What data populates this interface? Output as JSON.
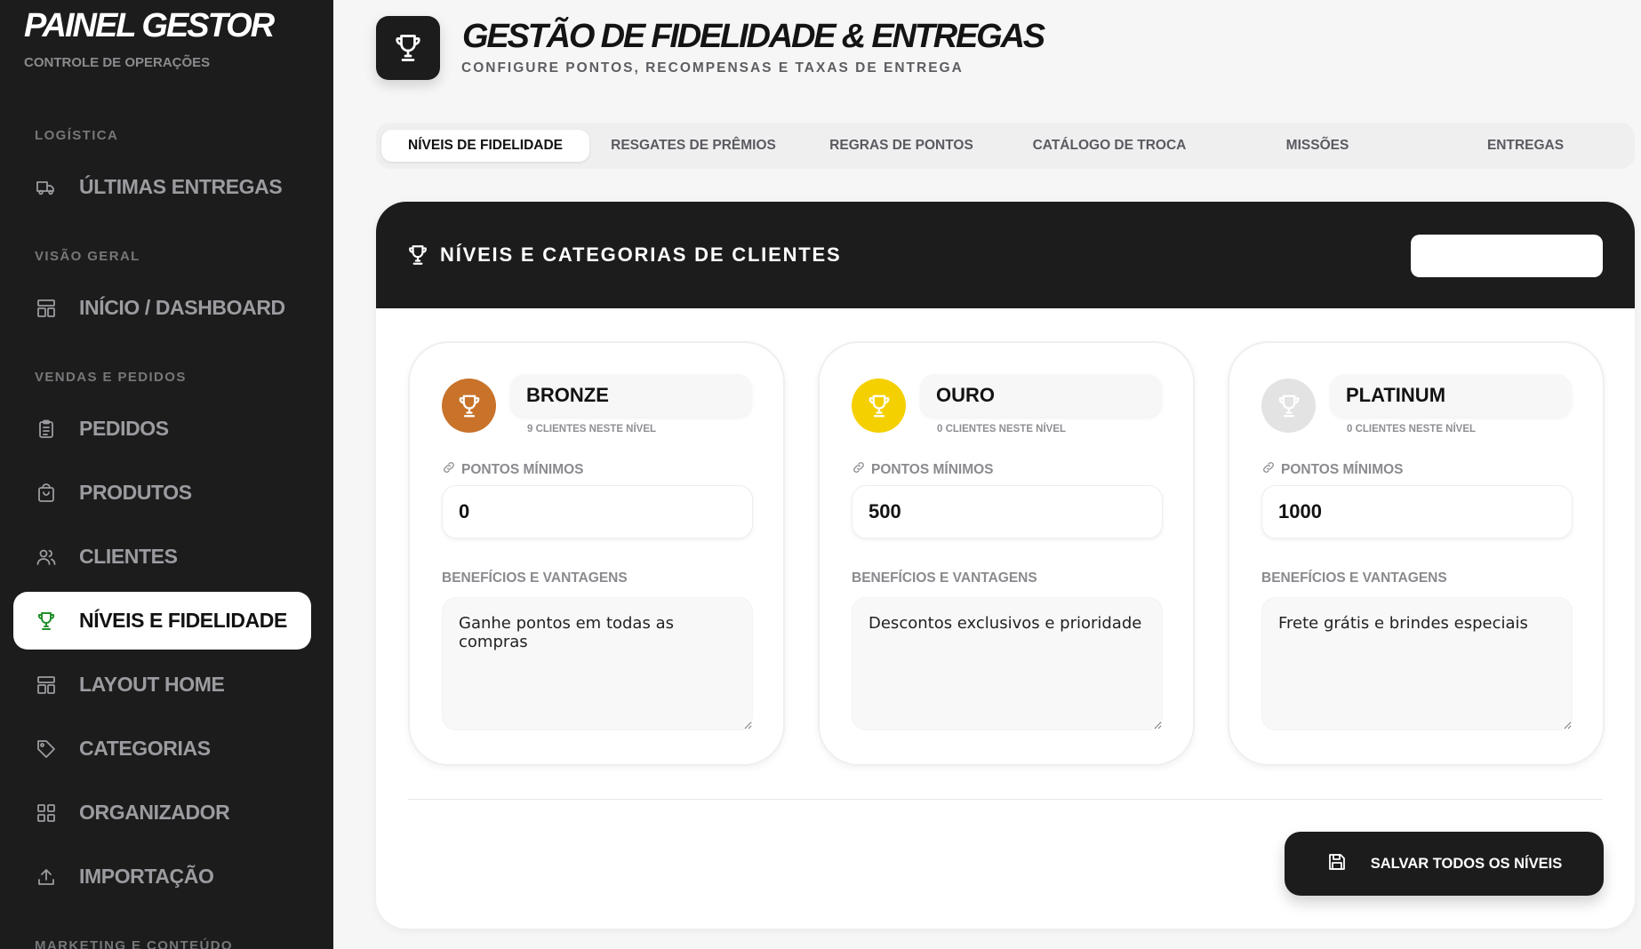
{
  "sidebar": {
    "brand": "PAINEL GESTOR",
    "brand_sub": "CONTROLE DE OPERAÇÕES",
    "sections": {
      "logistica": "LOGÍSTICA",
      "visao_geral": "VISÃO GERAL",
      "vendas": "VENDAS E PEDIDOS",
      "marketing": "MARKETING E CONTEÚDO"
    },
    "items": {
      "ultimas_entregas": "ÚLTIMAS ENTREGAS",
      "inicio": "INÍCIO / DASHBOARD",
      "pedidos": "PEDIDOS",
      "produtos": "PRODUTOS",
      "clientes": "CLIENTES",
      "niveis": "NÍVEIS E FIDELIDADE",
      "layout_home": "LAYOUT HOME",
      "categorias": "CATEGORIAS",
      "organizador": "ORGANIZADOR",
      "importacao": "IMPORTAÇÃO"
    },
    "active_item": "niveis"
  },
  "header": {
    "title": "GESTÃO DE FIDELIDADE & ENTREGAS",
    "subtitle": "CONFIGURE PONTOS, RECOMPENSAS E TAXAS DE ENTREGA",
    "icon": "trophy-icon"
  },
  "tabs": {
    "t0": "NÍVEIS DE FIDELIDADE",
    "t1": "RESGATES DE PRÊMIOS",
    "t2": "REGRAS DE PONTOS",
    "t3": "CATÁLOGO DE TROCA",
    "t4": "MISSÕES",
    "t5": "ENTREGAS",
    "active": "t0"
  },
  "card": {
    "title": "NÍVEIS E CATEGORIAS DE CLIENTES",
    "points_label": "PONTOS MÍNIMOS",
    "benefits_label": "BENEFÍCIOS E VANTAGENS",
    "levels": [
      {
        "name": "BRONZE",
        "count": "9 CLIENTES NESTE NÍVEL",
        "points": "0",
        "benefits": "Ganhe pontos em todas as compras",
        "color": "#c8722a"
      },
      {
        "name": "OURO",
        "count": "0 CLIENTES NESTE NÍVEL",
        "points": "500",
        "benefits": "Descontos exclusivos e prioridade",
        "color": "#f5d000"
      },
      {
        "name": "PLATINUM",
        "count": "0 CLIENTES NESTE NÍVEL",
        "points": "1000",
        "benefits": "Frete grátis e brindes especiais",
        "color": "#e3e3e3"
      }
    ],
    "save_label": "SALVAR TODOS OS NÍVEIS"
  },
  "colors": {
    "sidebar_bg": "#1c1c1d",
    "active_icon": "#1f8f2a",
    "accent_dark": "#1c1c1d"
  }
}
